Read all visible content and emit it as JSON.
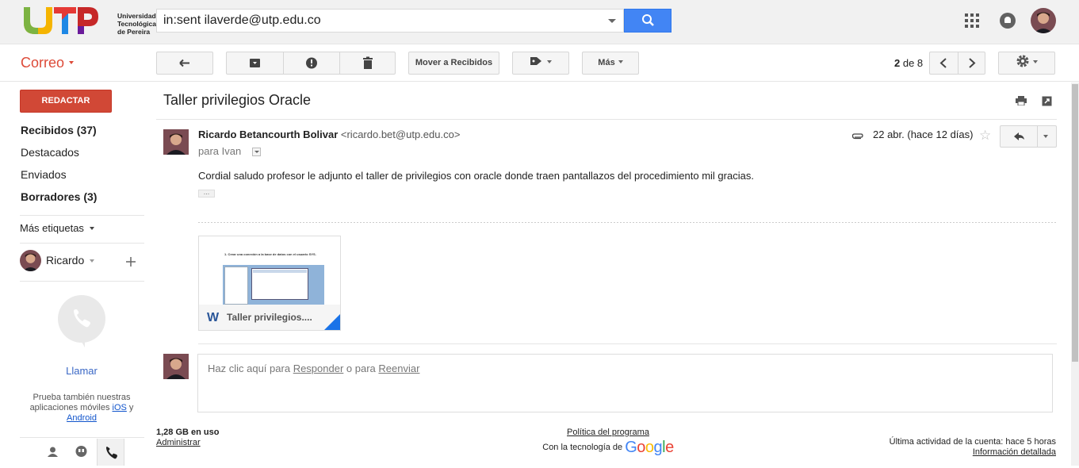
{
  "header": {
    "logo_text": "UTP",
    "logo_lines": [
      "Universidad",
      "Tecnológica",
      "de Pereira"
    ],
    "search_value": "in:sent ilaverde@utp.edu.co"
  },
  "toolbar": {
    "app_label": "Correo",
    "move_label": "Mover a Recibidos",
    "more_label": "Más",
    "pager_current": "2",
    "pager_of": "de 8"
  },
  "sidebar": {
    "compose_label": "REDACTAR",
    "items": [
      {
        "label": "Recibidos (37)",
        "bold": true
      },
      {
        "label": "Destacados",
        "bold": false
      },
      {
        "label": "Enviados",
        "bold": false
      },
      {
        "label": "Borradores (3)",
        "bold": true
      }
    ],
    "more_labels": "Más etiquetas",
    "hangouts_user": "Ricardo",
    "call_label": "Llamar",
    "promo_text": "Prueba también nuestras aplicaciones móviles",
    "promo_ios": "iOS",
    "promo_and": "y",
    "promo_android": "Android"
  },
  "message": {
    "subject": "Taller privilegios Oracle",
    "sender_name": "Ricardo Betancourth Bolivar",
    "sender_email": "<ricardo.bet@utp.edu.co>",
    "to": "para Ivan",
    "date": "22 abr. (hace 12 días)",
    "body": "Cordial saludo profesor le adjunto el taller de privilegios con oracle donde traen pantallazos del procedimiento mil gracias.",
    "attachment_name": "Taller privilegios....",
    "attachment_preview": "1. Crear una conexión a la base de datos con el usuario SYS."
  },
  "reply": {
    "prefix": "Haz clic aquí para",
    "reply_link": "Responder",
    "middle": "o para",
    "forward_link": "Reenviar"
  },
  "footer": {
    "storage": "1,28 GB en uso",
    "manage": "Administrar",
    "policy": "Política del programa",
    "powered": "Con la tecnología de",
    "activity": "Última actividad de la cuenta: hace 5 horas",
    "details": "Información detallada"
  },
  "colors": {
    "brand_red": "#dd4b39",
    "compose_red": "#d14836",
    "search_blue": "#4285f4"
  }
}
